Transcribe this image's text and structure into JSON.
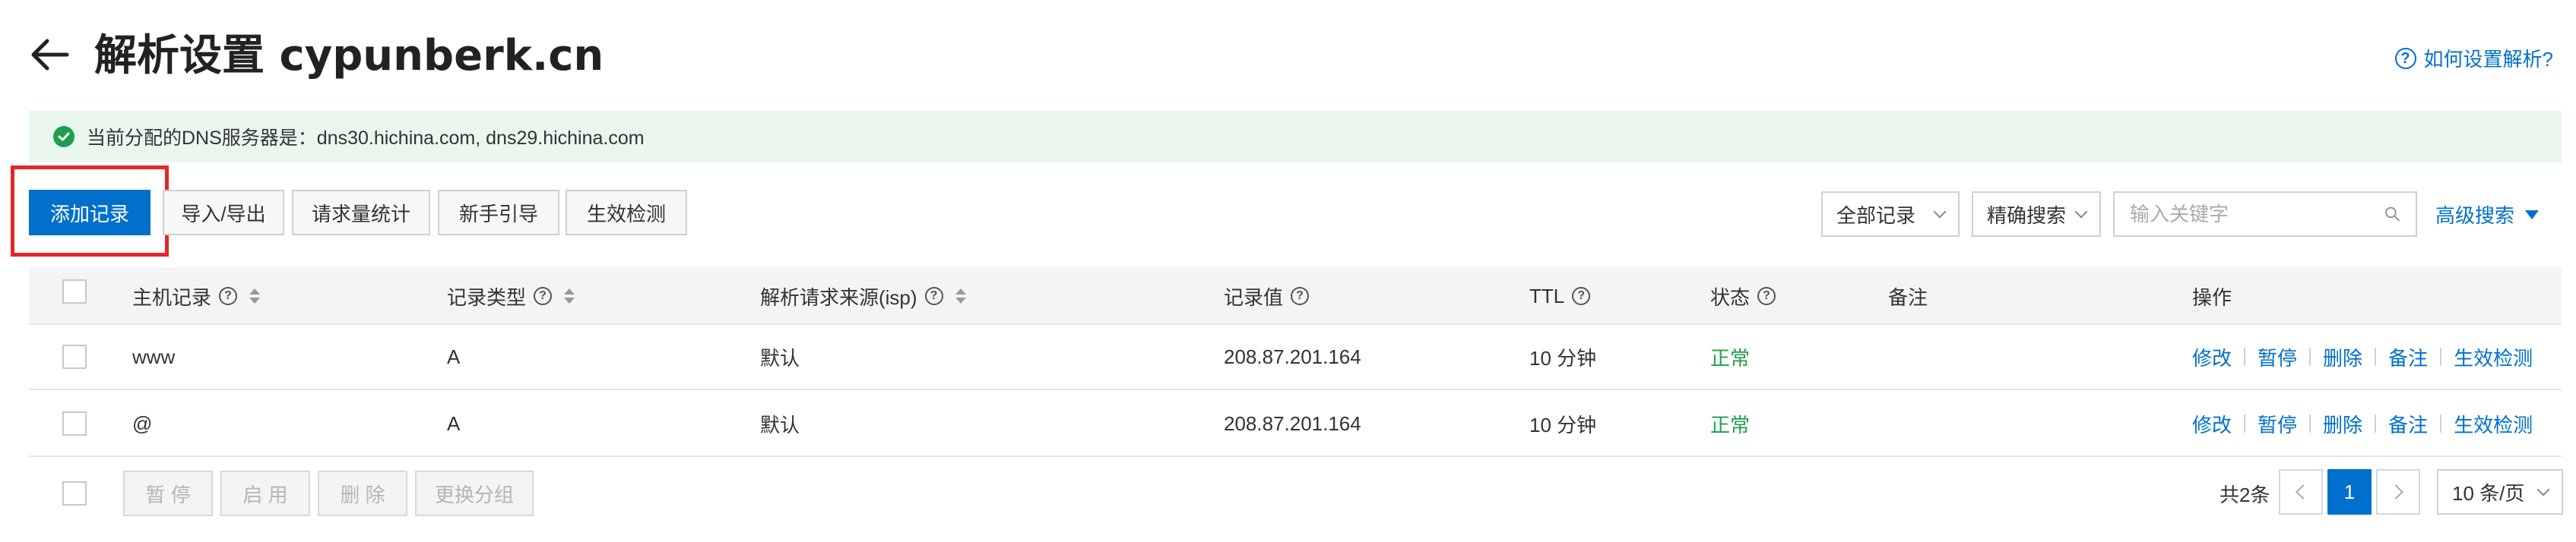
{
  "header": {
    "title": "解析设置 cypunberk.cn",
    "help_link": "如何设置解析?"
  },
  "notice": {
    "text": "当前分配的DNS服务器是：dns30.hichina.com, dns29.hichina.com"
  },
  "toolbar": {
    "add_record": "添加记录",
    "import_export": "导入/导出",
    "request_stats": "请求量统计",
    "beginner_guide": "新手引导",
    "effect_check": "生效检测",
    "record_filter": "全部记录",
    "match_mode": "精确搜索",
    "search_placeholder": "输入关键字",
    "advanced_search": "高级搜索"
  },
  "table": {
    "columns": {
      "host": "主机记录",
      "type": "记录类型",
      "isp": "解析请求来源(isp)",
      "value": "记录值",
      "ttl": "TTL",
      "status": "状态",
      "remark": "备注",
      "actions": "操作"
    },
    "rows": [
      {
        "host": "www",
        "type": "A",
        "isp": "默认",
        "value": "208.87.201.164",
        "ttl": "10 分钟",
        "status": "正常",
        "remark": ""
      },
      {
        "host": "@",
        "type": "A",
        "isp": "默认",
        "value": "208.87.201.164",
        "ttl": "10 分钟",
        "status": "正常",
        "remark": ""
      }
    ],
    "row_actions": {
      "edit": "修改",
      "pause": "暂停",
      "delete": "删除",
      "remark": "备注",
      "effect_check": "生效检测"
    }
  },
  "footer": {
    "pause": "暂 停",
    "enable": "启 用",
    "delete": "删 除",
    "change_group": "更换分组",
    "total": "共2条",
    "current_page": "1",
    "page_size": "10 条/页"
  },
  "colors": {
    "primary": "#0070cc",
    "success": "#1e9f4e",
    "highlight": "#e4262a",
    "notice_bg": "#e9f7ee"
  }
}
